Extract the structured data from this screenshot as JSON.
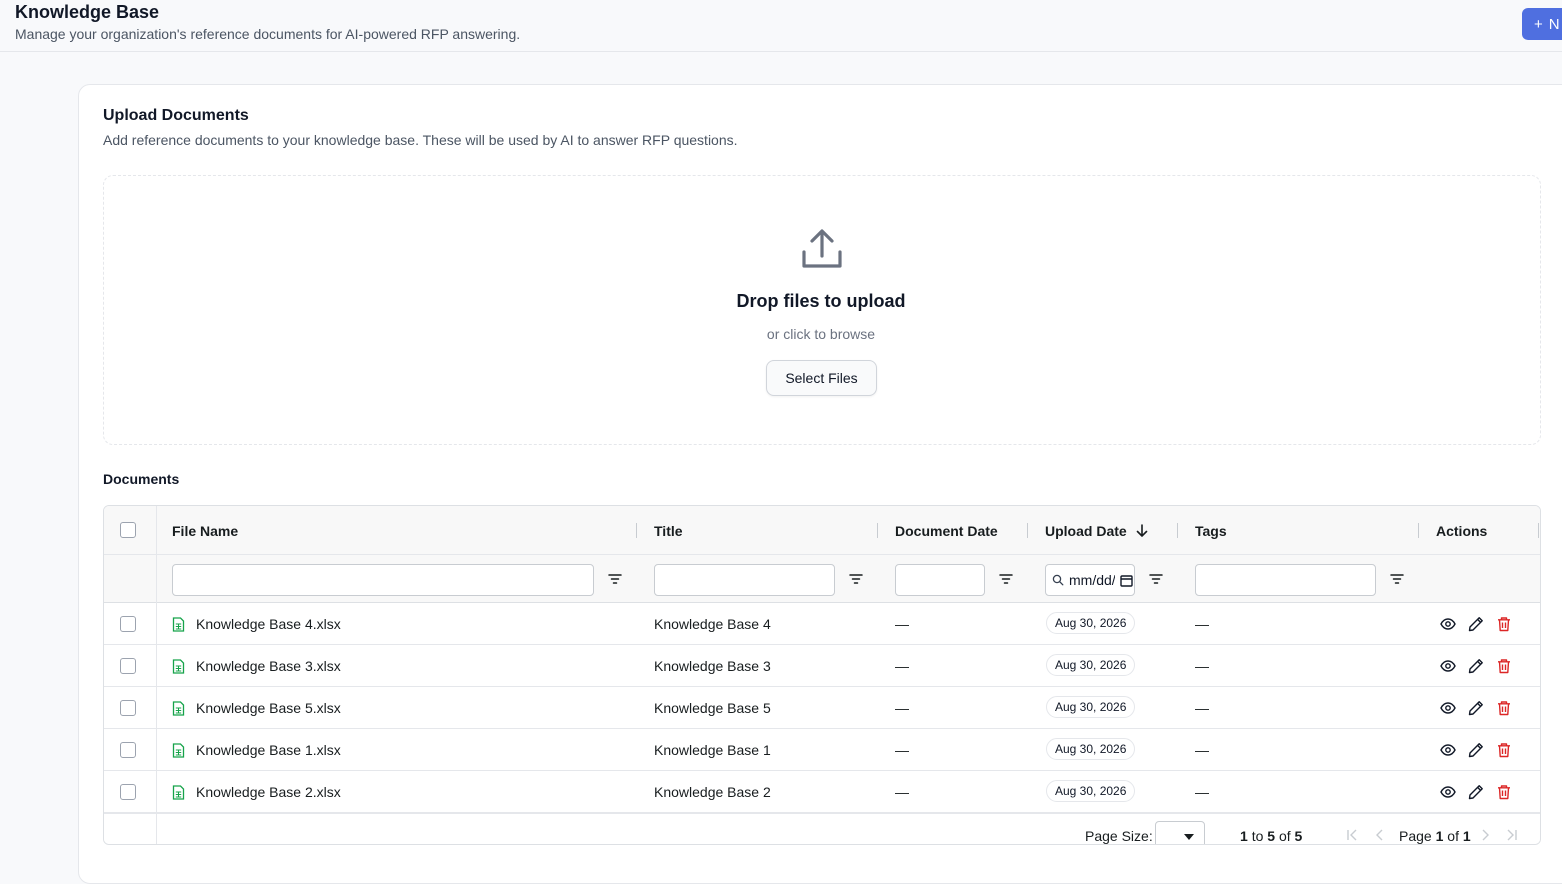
{
  "header": {
    "title": "Knowledge Base",
    "subtitle": "Manage your organization's reference documents for AI-powered RFP answering.",
    "new_button_label": "N"
  },
  "upload": {
    "title": "Upload Documents",
    "description": "Add reference documents to your knowledge base. These will be used by AI to answer RFP questions.",
    "drop_title": "Drop files to upload",
    "drop_subtitle": "or click to browse",
    "select_button": "Select Files"
  },
  "documents": {
    "title": "Documents",
    "columns": [
      "File Name",
      "Title",
      "Document Date",
      "Upload Date",
      "Tags",
      "Actions"
    ],
    "upload_date_filter_placeholder": "mm/dd/yyyy",
    "rows": [
      {
        "file_name": "Knowledge Base 4.xlsx",
        "title": "Knowledge Base 4",
        "document_date": "—",
        "upload_date": "Aug 30, 2026",
        "tags": "—"
      },
      {
        "file_name": "Knowledge Base 3.xlsx",
        "title": "Knowledge Base 3",
        "document_date": "—",
        "upload_date": "Aug 30, 2026",
        "tags": "—"
      },
      {
        "file_name": "Knowledge Base 5.xlsx",
        "title": "Knowledge Base 5",
        "document_date": "—",
        "upload_date": "Aug 30, 2026",
        "tags": "—"
      },
      {
        "file_name": "Knowledge Base 1.xlsx",
        "title": "Knowledge Base 1",
        "document_date": "—",
        "upload_date": "Aug 30, 2026",
        "tags": "—"
      },
      {
        "file_name": "Knowledge Base 2.xlsx",
        "title": "Knowledge Base 2",
        "document_date": "—",
        "upload_date": "Aug 30, 2026",
        "tags": "—"
      }
    ],
    "pagination": {
      "page_size_label": "Page Size:",
      "range_from": "1",
      "range_to_label": "to",
      "range_to": "5",
      "of_label": "of",
      "total": "5",
      "page_label": "Page",
      "page_current": "1",
      "page_total": "1"
    }
  },
  "colors": {
    "accent": "#4f6fe0",
    "file_icon": "#16a34a",
    "delete_icon": "#dc2626"
  }
}
